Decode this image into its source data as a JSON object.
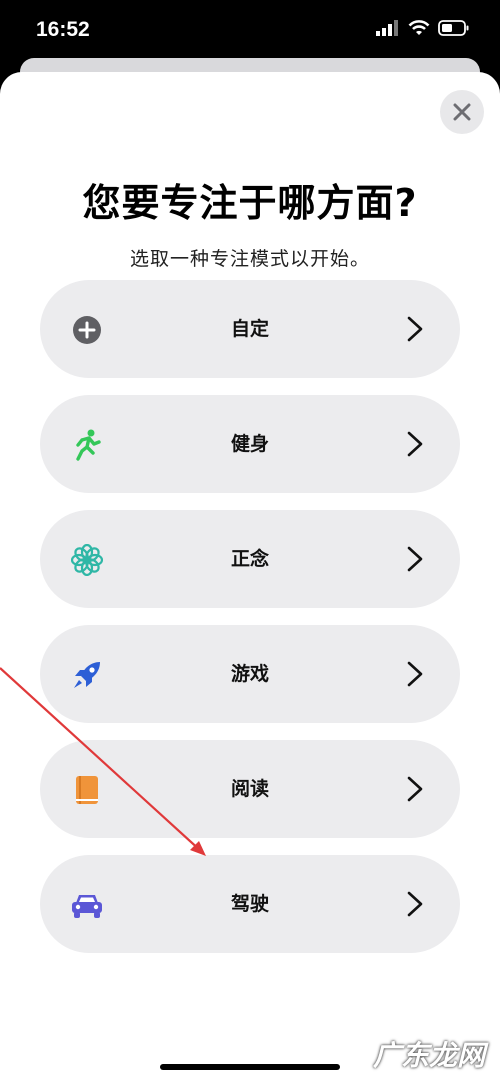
{
  "status": {
    "time": "16:52"
  },
  "close_icon": "close-x",
  "title": "您要专注于哪方面?",
  "subtitle": "选取一种专注模式以开始。",
  "modes": [
    {
      "label": "自定",
      "icon": "plus-circle-icon",
      "color": "#5f5f63"
    },
    {
      "label": "健身",
      "icon": "running-icon",
      "color": "#34c759"
    },
    {
      "label": "正念",
      "icon": "flower-icon",
      "color": "#2fb7a6"
    },
    {
      "label": "游戏",
      "icon": "rocket-icon",
      "color": "#2d5fd6"
    },
    {
      "label": "阅读",
      "icon": "book-icon",
      "color": "#f0943a"
    },
    {
      "label": "驾驶",
      "icon": "car-icon",
      "color": "#5b57d6"
    }
  ],
  "watermark": "广东龙网"
}
